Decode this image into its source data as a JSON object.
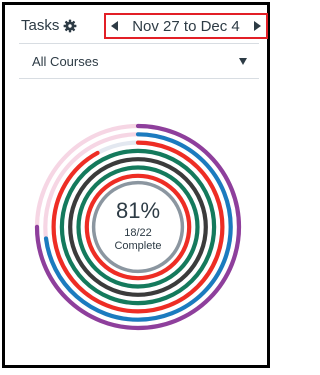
{
  "header": {
    "title": "Tasks",
    "gear_icon": "gear-icon",
    "date_range": "Nov 27 to Dec 4",
    "prev_icon": "caret-left-icon",
    "next_icon": "caret-right-icon",
    "highlight_color": "#e21f26"
  },
  "filter": {
    "selected": "All Courses",
    "dropdown_icon": "caret-down-icon"
  },
  "progress": {
    "percent": "81%",
    "fraction": "18/22",
    "label": "Complete",
    "rings": [
      {
        "color": "#8e3f9c",
        "track": "#f6d6e4",
        "fraction": 0.75
      },
      {
        "color": "#1b7bbf",
        "track": "#f6d6e4",
        "fraction": 0.73
      },
      {
        "color": "#ee2d24",
        "track": "#e3e8f0",
        "fraction": 0.92
      },
      {
        "color": "#147a5c",
        "track": "#e3e8f0",
        "fraction": 1.0
      },
      {
        "color": "#3b3b3b",
        "track": "#e3e8f0",
        "fraction": 1.0
      },
      {
        "color": "#147a5c",
        "track": "#e3e8f0",
        "fraction": 1.0
      },
      {
        "color": "#ee2d24",
        "track": "#e3e8f0",
        "fraction": 1.0
      }
    ]
  }
}
